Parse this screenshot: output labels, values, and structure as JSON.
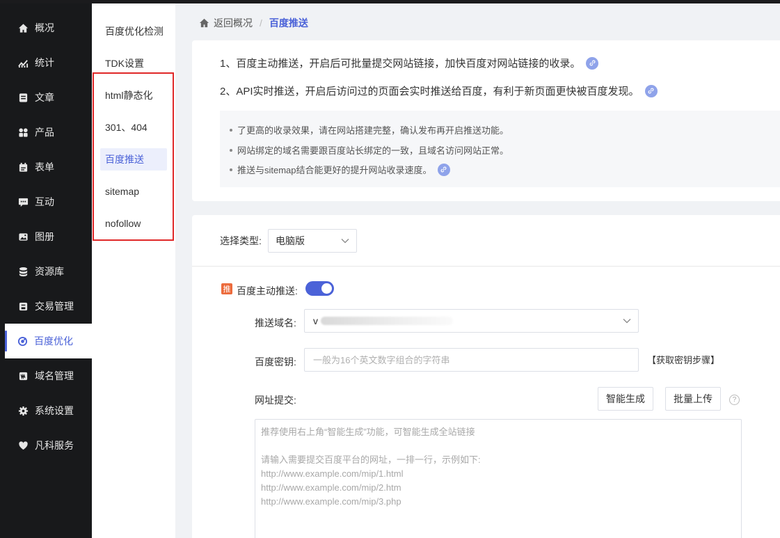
{
  "sidebar": {
    "items": [
      {
        "label": "概况",
        "icon": "home-icon"
      },
      {
        "label": "统计",
        "icon": "chart-icon"
      },
      {
        "label": "文章",
        "icon": "article-icon"
      },
      {
        "label": "产品",
        "icon": "grid-icon"
      },
      {
        "label": "表单",
        "icon": "calendar-icon"
      },
      {
        "label": "互动",
        "icon": "chat-icon"
      },
      {
        "label": "图册",
        "icon": "image-icon"
      },
      {
        "label": "资源库",
        "icon": "database-icon"
      },
      {
        "label": "交易管理",
        "icon": "trade-icon"
      },
      {
        "label": "百度优化",
        "icon": "baidu-icon"
      },
      {
        "label": "域名管理",
        "icon": "domain-icon"
      },
      {
        "label": "系统设置",
        "icon": "gear-icon"
      },
      {
        "label": "凡科服务",
        "icon": "heart-icon"
      }
    ],
    "active": "百度优化"
  },
  "submenu": {
    "items": [
      "百度优化检测",
      "TDK设置",
      "html静态化",
      "301、404",
      "百度推送",
      "sitemap",
      "nofollow"
    ],
    "active": "百度推送"
  },
  "breadcrumb": {
    "home": "返回概况",
    "separator": "/",
    "current": "百度推送"
  },
  "intro": {
    "line1": "1、百度主动推送，开启后可批量提交网站链接，加快百度对网站链接的收录。",
    "line2": "2、API实时推送，开启后访问过的页面会实时推送给百度，有利于新页面更快被百度发现。",
    "tips": [
      "了更高的收录效果，请在网站搭建完整，确认发布再开启推送功能。",
      "网站绑定的域名需要跟百度站长绑定的一致，且域名访问网站正常。",
      "推送与sitemap结合能更好的提升网站收录速度。"
    ]
  },
  "form": {
    "type_label": "选择类型:",
    "type_value": "电脑版",
    "push_badge": "推",
    "push_label": "百度主动推送:",
    "push_enabled": true,
    "domain_label": "推送域名:",
    "domain_value_visible": "v",
    "key_label": "百度密钥:",
    "key_placeholder": "一般为16个英文数字组合的字符串",
    "key_link": "【获取密钥步骤】",
    "url_label": "网址提交:",
    "btn_generate": "智能生成",
    "btn_upload": "批量上传",
    "help_symbol": "?",
    "textarea_lines": [
      "推荐使用右上角“智能生成”功能，可智能生成全站链接",
      "",
      "请输入需要提交百度平台的网址，一排一行，示例如下:",
      "http://www.example.com/mip/1.html",
      "http://www.example.com/mip/2.htm",
      "http://www.example.com/mip/3.php"
    ]
  },
  "colors": {
    "accent": "#4b62d8",
    "sidebar_bg": "#18191b",
    "highlight": "#e02828",
    "badge": "#ec6b3c"
  }
}
